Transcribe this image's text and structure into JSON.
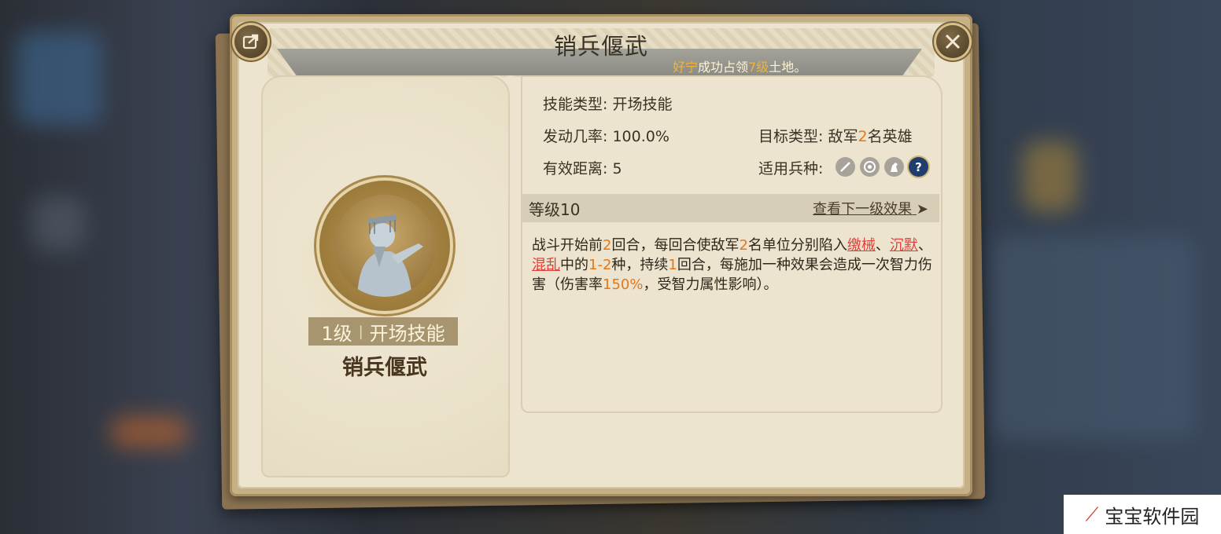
{
  "dialog": {
    "title": "销兵偃武",
    "notice": {
      "player": "好宁",
      "before": "成功占领",
      "level": "7级",
      "after": "土地。"
    },
    "share_icon": "share-icon",
    "close_icon": "close-icon"
  },
  "skill": {
    "level_label": "1级",
    "separator": "|",
    "type_label": "开场技能",
    "name": "销兵偃武"
  },
  "details": {
    "skill_type_label": "技能类型:",
    "skill_type_value": "开场技能",
    "trigger_rate_label": "发动几率:",
    "trigger_rate_value": "100.0%",
    "range_label": "有效距离:",
    "range_value": "5",
    "target_label": "目标类型:",
    "target_pre": "敌军",
    "target_num": "2",
    "target_post": "名英雄",
    "troops_label": "适用兵种:",
    "troop_icons": [
      "infantry-icon",
      "archer-icon",
      "cavalry-icon",
      "unknown-icon"
    ]
  },
  "level_bar": {
    "level": "等级10",
    "next": "查看下一级效果"
  },
  "description": {
    "p1": "战斗开始前",
    "n1": "2",
    "p2": "回合，每回合使敌军",
    "n2": "2",
    "p3": "名单位分别陷入",
    "s1": "缴械",
    "p4": "、",
    "s2": "沉默",
    "p5": "、",
    "s3": "混乱",
    "p6": "中的",
    "n3": "1-2",
    "p7": "种，持续",
    "n4": "1",
    "p8": "回合，每施加一种效果会造成一次智力伤害（伤害率",
    "n5": "150%",
    "p9": "，受智力属性影响）。"
  },
  "watermark": "宝宝软件园"
}
